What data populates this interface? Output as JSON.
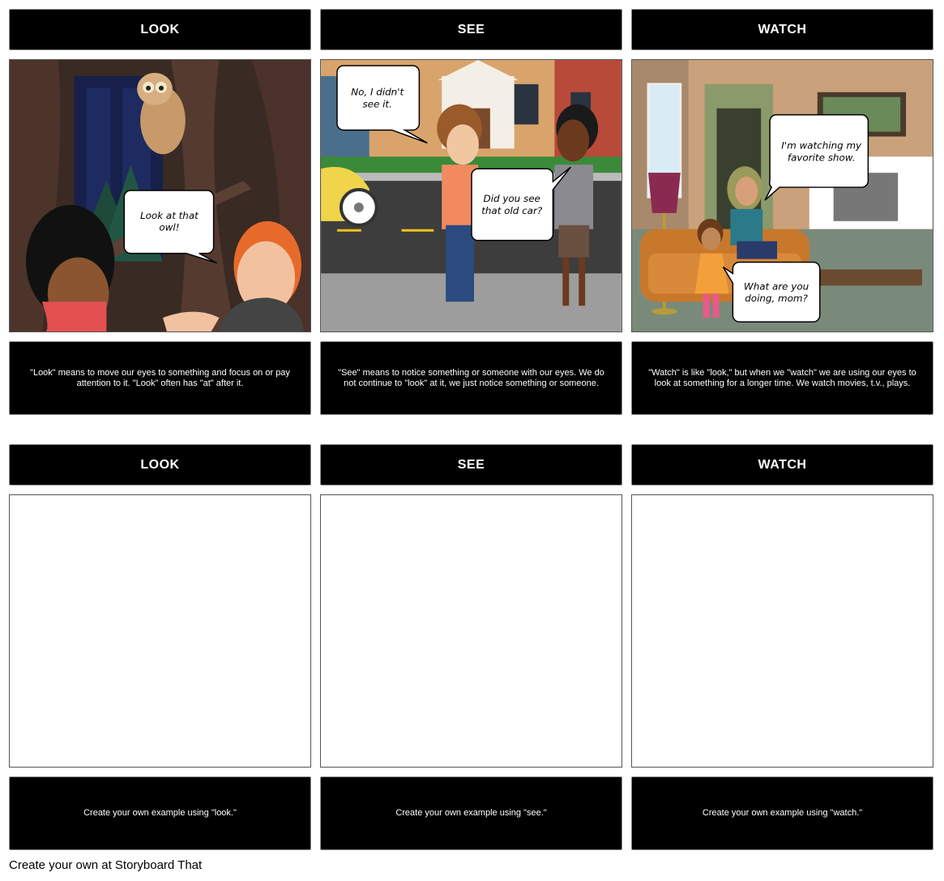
{
  "rows": [
    {
      "panels": [
        {
          "title": "LOOK",
          "caption": "\"Look\" means to move our eyes to something and focus on or pay attention to it. \"Look\" often has \"at\" after it."
        },
        {
          "title": "SEE",
          "caption": "\"See\" means to notice something or someone with our eyes. We do not continue to \"look\" at it, we just notice something or someone."
        },
        {
          "title": "WATCH",
          "caption": "\"Watch\" is like \"look,\" but when we \"watch\" we are using our eyes to look at something for a longer time. We watch movies, t.v., plays."
        }
      ]
    },
    {
      "panels": [
        {
          "title": "LOOK",
          "caption": "Create your own example using \"look.\""
        },
        {
          "title": "SEE",
          "caption": "Create your own example using \"see.\""
        },
        {
          "title": "WATCH",
          "caption": "Create your own example using \"watch.\""
        }
      ]
    }
  ],
  "bubbles": {
    "look": {
      "line1": "Look at that",
      "line2": "owl!"
    },
    "see_a": {
      "line1": "No, I didn't",
      "line2": "see it."
    },
    "see_b": {
      "line1": "Did you see",
      "line2": "that old car?"
    },
    "watch_a": {
      "line1": "I'm watching my",
      "line2": "favorite show."
    },
    "watch_b": {
      "line1": "What are you",
      "line2": "doing, mom?"
    }
  },
  "footer": "Create your own at Storyboard That"
}
